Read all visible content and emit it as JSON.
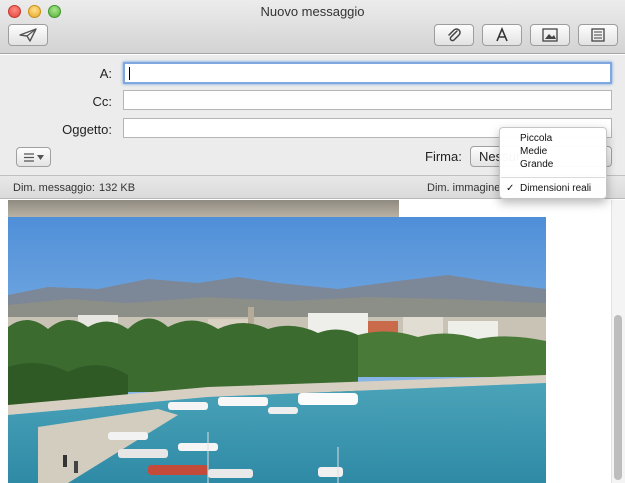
{
  "window": {
    "title": "Nuovo messaggio"
  },
  "toolbar": {
    "send": "send-icon",
    "attach": "paperclip-icon",
    "format": "font-icon",
    "photo": "photo-browser-icon",
    "template": "stationery-icon"
  },
  "header": {
    "to_label": "A:",
    "to_value": "",
    "cc_label": "Cc:",
    "cc_value": "",
    "subject_label": "Oggetto:",
    "subject_value": "",
    "signature_label": "Firma:",
    "signature_value": "Nessuna"
  },
  "infobar": {
    "message_size_label": "Dim. messaggio:",
    "message_size_value": "132 KB",
    "image_size_label": "Dim. immagine:"
  },
  "image_size_menu": {
    "options": [
      {
        "label": "Piccola"
      },
      {
        "label": "Medie"
      },
      {
        "label": "Grande"
      },
      {
        "label": "Dimensioni reali"
      }
    ],
    "selected": "Dimensioni reali",
    "check_mark": "✓"
  }
}
